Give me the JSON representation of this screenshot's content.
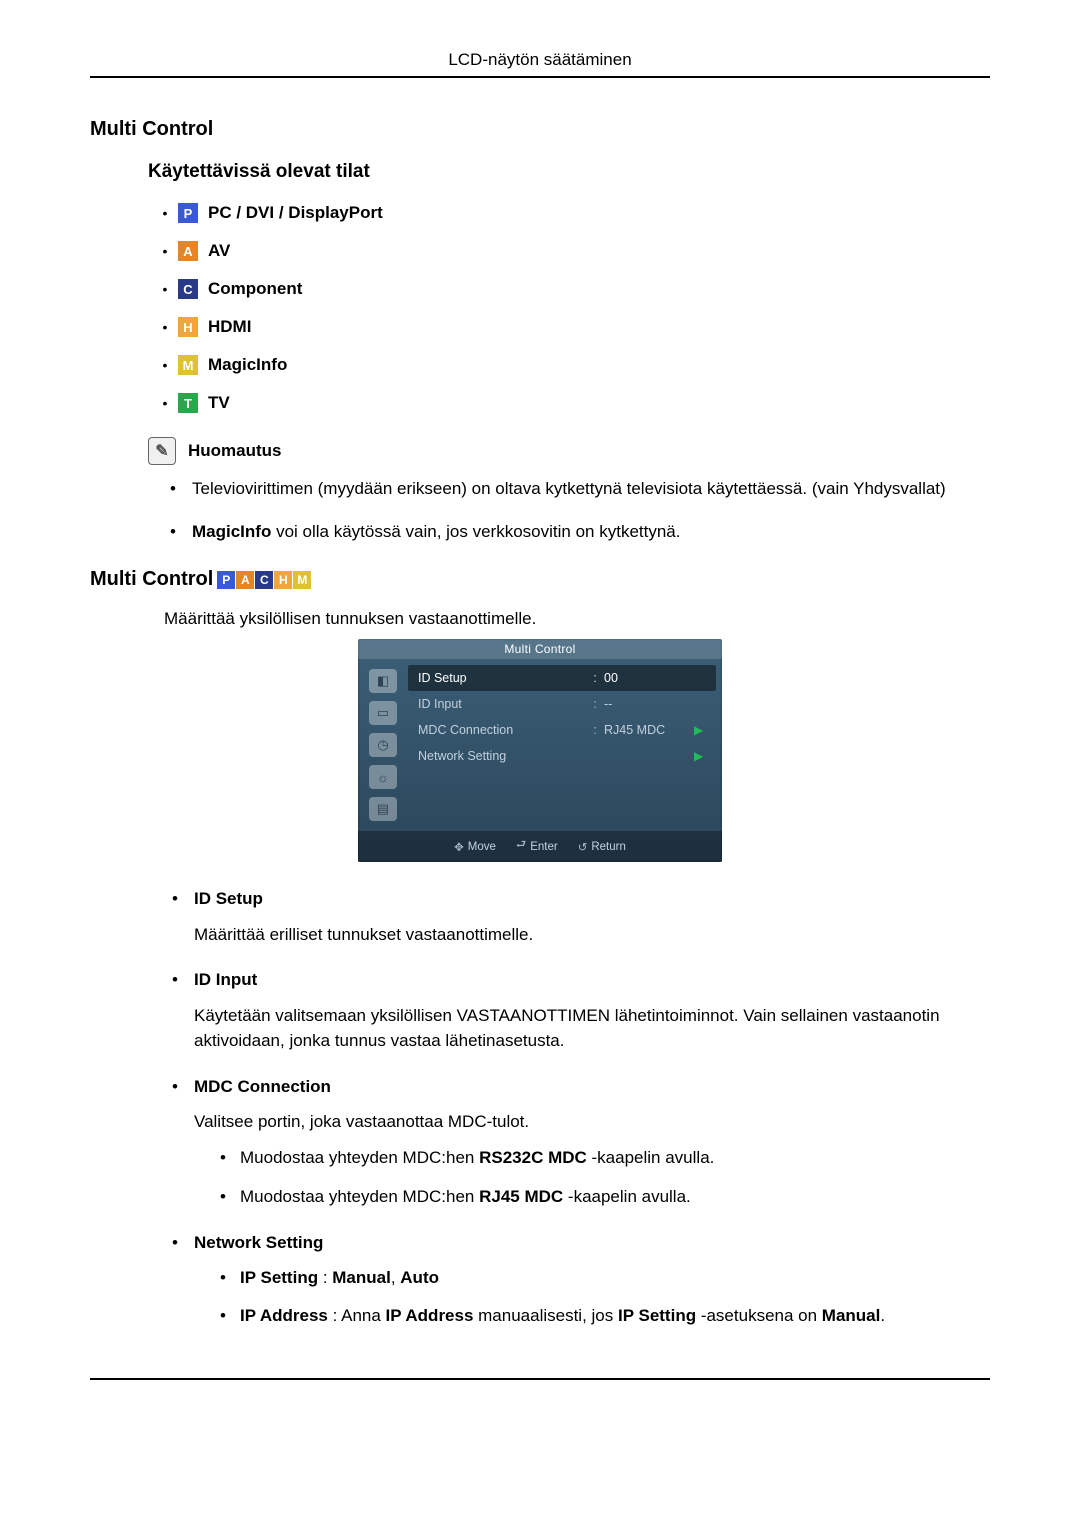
{
  "header": {
    "title": "LCD-näytön säätäminen"
  },
  "section1": {
    "heading": "Multi Control",
    "subheading": "Käytettävissä olevat tilat",
    "modes": [
      {
        "letter": "P",
        "label": "PC / DVI / DisplayPort",
        "cls": "icon-p"
      },
      {
        "letter": "A",
        "label": "AV",
        "cls": "icon-a"
      },
      {
        "letter": "C",
        "label": "Component",
        "cls": "icon-c"
      },
      {
        "letter": "H",
        "label": "HDMI",
        "cls": "icon-h"
      },
      {
        "letter": "M",
        "label": "MagicInfo",
        "cls": "icon-m"
      },
      {
        "letter": "T",
        "label": "TV",
        "cls": "icon-t"
      }
    ],
    "note_label": "Huomautus",
    "notes": [
      {
        "text": "Televiovirittimen (myydään erikseen) on oltava kytkettynä televisiota käytettäessä. (vain Yhdysvallat)",
        "bold_prefix": ""
      },
      {
        "bold_prefix": "MagicInfo",
        "text": " voi olla käytössä vain, jos verkkosovitin on kytkettynä."
      }
    ]
  },
  "section2": {
    "heading": "Multi Control",
    "desc": "Määrittää yksilöllisen tunnuksen vastaanottimelle.",
    "osd": {
      "title": "Multi Control",
      "rows": [
        {
          "label": "ID Setup",
          "val": "00",
          "sel": true,
          "arrow": false
        },
        {
          "label": "ID Input",
          "val": "--",
          "sel": false,
          "arrow": false
        },
        {
          "label": "MDC Connection",
          "val": "RJ45 MDC",
          "sel": false,
          "arrow": true
        },
        {
          "label": "Network Setting",
          "val": "",
          "sel": false,
          "arrow": true
        }
      ],
      "footer": {
        "move": "Move",
        "enter": "Enter",
        "ret": "Return"
      }
    },
    "defs": [
      {
        "term": "ID Setup",
        "body": "Määrittää erilliset tunnukset vastaanottimelle."
      },
      {
        "term": "ID Input",
        "body": "Käytetään valitsemaan yksilöllisen VASTAANOTTIMEN lähetintoiminnot. Vain sellainen vastaanotin aktivoidaan, jonka tunnus vastaa lähetinasetusta."
      },
      {
        "term": "MDC Connection",
        "body": "Valitsee portin, joka vastaanottaa MDC-tulot.",
        "sub": [
          {
            "pre": "Muodostaa yhteyden MDC:hen ",
            "bold": "RS232C MDC",
            "post": " -kaapelin avulla."
          },
          {
            "pre": "Muodostaa yhteyden MDC:hen ",
            "bold": "RJ45 MDC",
            "post": " -kaapelin avulla."
          }
        ]
      },
      {
        "term": "Network Setting",
        "sub2": [
          {
            "b1": "IP Setting",
            "mid": " : ",
            "b2": "Manual",
            "comma": ", ",
            "b3": "Auto"
          },
          {
            "b1": "IP Address",
            "mid": " : Anna ",
            "b2": "IP Address",
            "post1": " manuaalisesti, jos ",
            "b3": "IP Setting",
            "post2": " -asetuksena on ",
            "b4": "Manual",
            "tail": "."
          }
        ]
      }
    ]
  }
}
